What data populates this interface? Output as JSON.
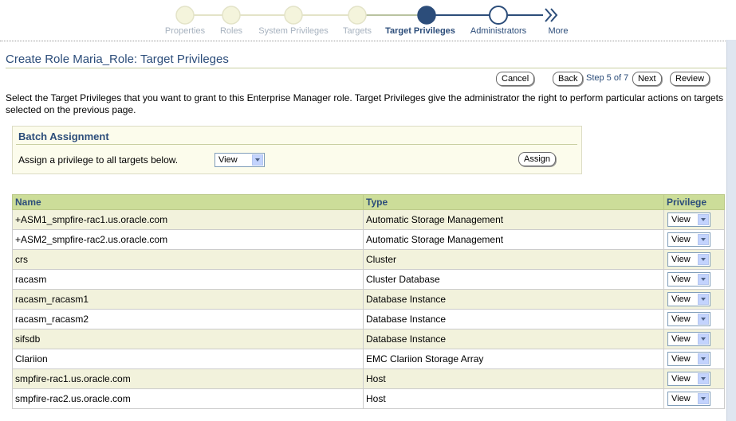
{
  "train": {
    "steps": [
      {
        "label": "Properties",
        "state": "visited"
      },
      {
        "label": "Roles",
        "state": "visited"
      },
      {
        "label": "System Privileges",
        "state": "visited"
      },
      {
        "label": "Targets",
        "state": "visited"
      },
      {
        "label": "Target Privileges",
        "state": "current"
      },
      {
        "label": "Administrators",
        "state": "next"
      },
      {
        "label": "More",
        "state": "more"
      }
    ]
  },
  "header": {
    "title": "Create Role Maria_Role: Target Privileges",
    "cancel_label": "Cancel",
    "back_label": "Back",
    "step_text": "Step 5 of 7",
    "next_label": "Next",
    "review_label": "Review"
  },
  "instruction": "Select the Target Privileges that you want to grant to this Enterprise Manager role. Target Privileges give the administrator the right to perform particular actions on targets selected on the previous page.",
  "batch": {
    "title": "Batch Assignment",
    "label": "Assign a privilege to all targets below.",
    "selected": "View",
    "assign_label": "Assign"
  },
  "table": {
    "columns": [
      "Name",
      "Type",
      "Privilege"
    ],
    "rows": [
      {
        "name": "+ASM1_smpfire-rac1.us.oracle.com",
        "type": "Automatic Storage Management",
        "privilege": "View"
      },
      {
        "name": "+ASM2_smpfire-rac2.us.oracle.com",
        "type": "Automatic Storage Management",
        "privilege": "View"
      },
      {
        "name": "crs",
        "type": "Cluster",
        "privilege": "View"
      },
      {
        "name": "racasm",
        "type": "Cluster Database",
        "privilege": "View"
      },
      {
        "name": "racasm_racasm1",
        "type": "Database Instance",
        "privilege": "View"
      },
      {
        "name": "racasm_racasm2",
        "type": "Database Instance",
        "privilege": "View"
      },
      {
        "name": "sifsdb",
        "type": "Database Instance",
        "privilege": "View"
      },
      {
        "name": "Clariion",
        "type": "EMC Clariion Storage Array",
        "privilege": "View"
      },
      {
        "name": "smpfire-rac1.us.oracle.com",
        "type": "Host",
        "privilege": "View"
      },
      {
        "name": "smpfire-rac2.us.oracle.com",
        "type": "Host",
        "privilege": "View"
      }
    ]
  },
  "colors": {
    "accent": "#2c4d7a",
    "header_bg": "#ccdd99",
    "row_alt": "#f2f2dc",
    "visited_step": "#f4f4dc"
  }
}
